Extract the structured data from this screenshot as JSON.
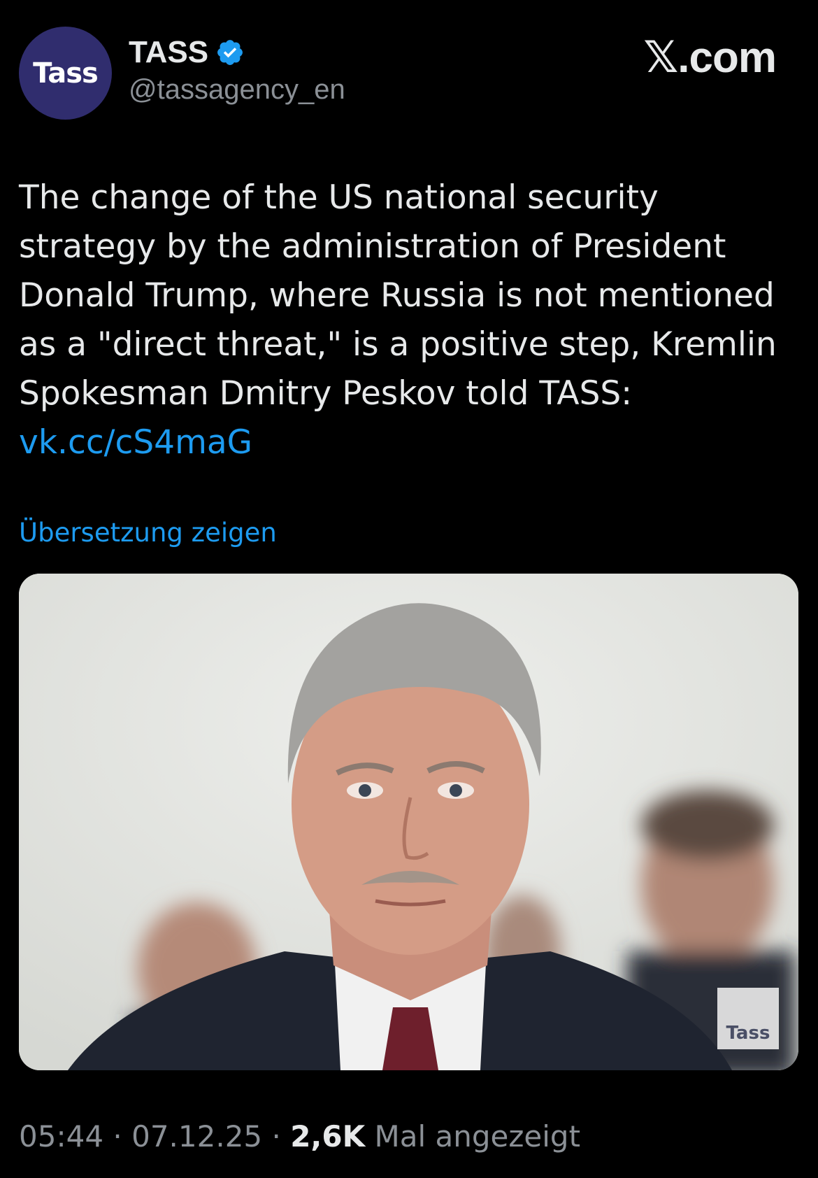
{
  "header": {
    "avatar_text": "Tass",
    "display_name": "TASS",
    "handle": "@tassagency_en",
    "watermark": "𝕏.com",
    "verified_color": "#1d9bf0"
  },
  "tweet": {
    "text": "The change of the US national security strategy by the administration of President Donald Trump, where Russia is not mentioned as a \"direct threat,\" is a positive step, Kremlin Spokesman Dmitry Peskov told TASS:",
    "link": "vk.cc/cS4maG",
    "translate_label": "Übersetzung zeigen"
  },
  "media": {
    "badge_text": "Tass",
    "icon": "photo"
  },
  "meta": {
    "time": "05:44",
    "sep1": " · ",
    "date": "07.12.25",
    "sep2": " · ",
    "views": "2,6K",
    "views_label": " Mal angezeigt"
  }
}
